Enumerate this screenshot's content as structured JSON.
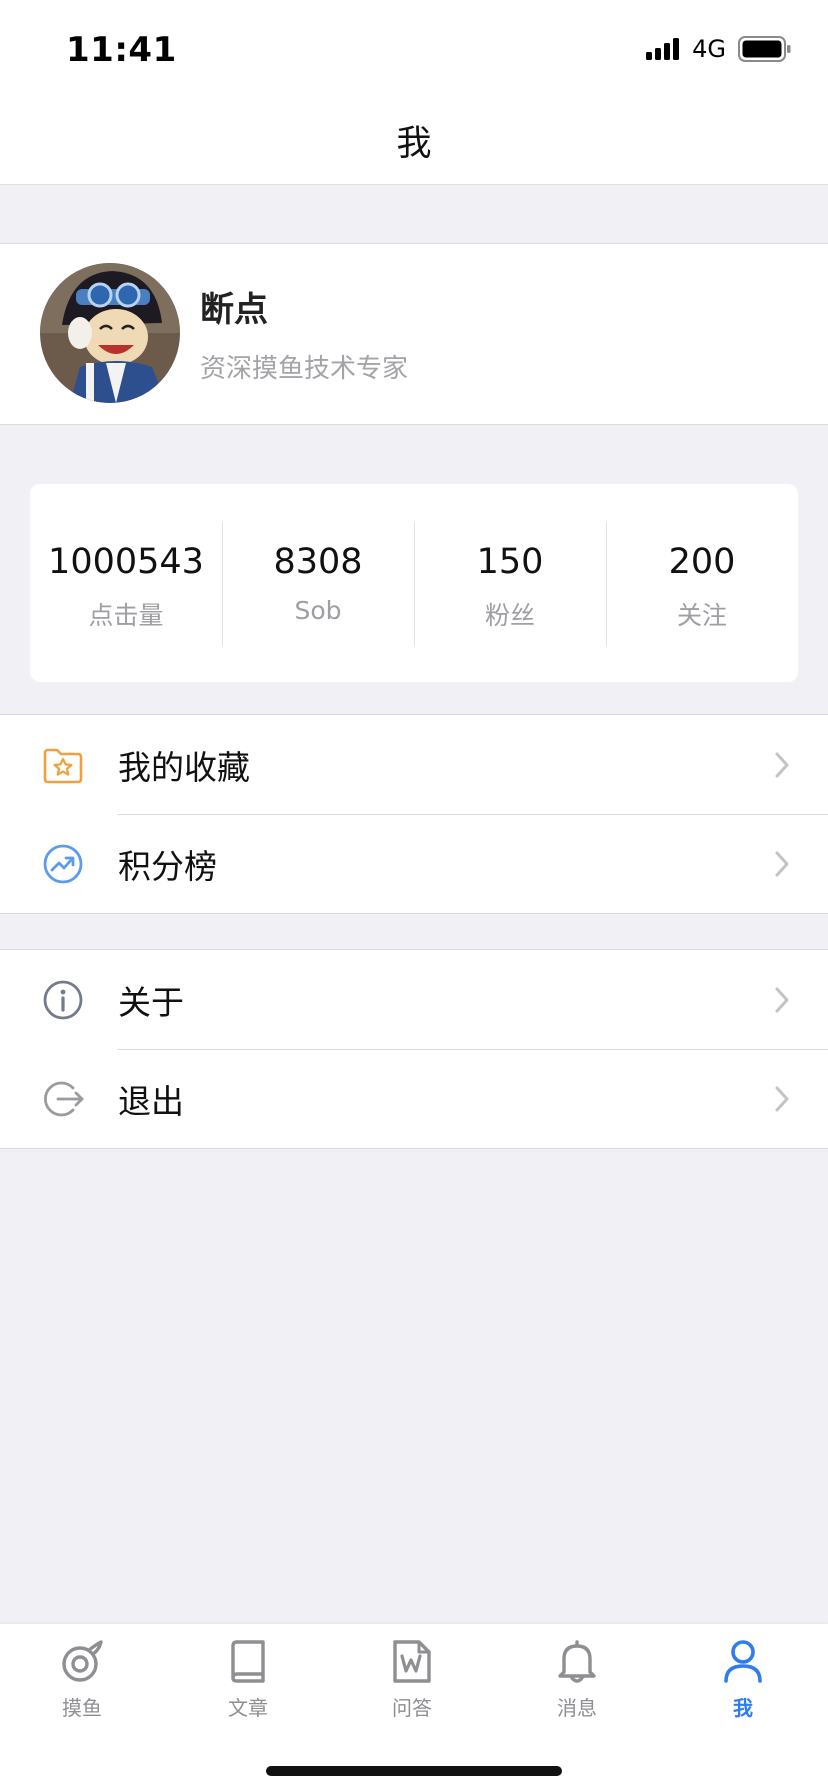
{
  "status_bar": {
    "time": "11:41",
    "network": "4G"
  },
  "nav": {
    "title": "我"
  },
  "profile": {
    "name": "断点",
    "subtitle": "资深摸鱼技术专家"
  },
  "stats": [
    {
      "value": "1000543",
      "label": "点击量"
    },
    {
      "value": "8308",
      "label": "Sob"
    },
    {
      "value": "150",
      "label": "粉丝"
    },
    {
      "value": "200",
      "label": "关注"
    }
  ],
  "menu": {
    "group1": [
      {
        "label": "我的收藏",
        "icon": "star-folder-icon",
        "color": "#f0a03c"
      },
      {
        "label": "积分榜",
        "icon": "trending-icon",
        "color": "#5b9bef"
      }
    ],
    "group2": [
      {
        "label": "关于",
        "icon": "info-icon",
        "color": "#737b8c"
      },
      {
        "label": "退出",
        "icon": "logout-icon",
        "color": "#9a9a9f"
      }
    ]
  },
  "tabs": [
    {
      "label": "摸鱼",
      "icon": "fish-icon",
      "active": false
    },
    {
      "label": "文章",
      "icon": "book-icon",
      "active": false
    },
    {
      "label": "问答",
      "icon": "qa-doc-icon",
      "active": false
    },
    {
      "label": "消息",
      "icon": "bell-icon",
      "active": false
    },
    {
      "label": "我",
      "icon": "person-icon",
      "active": true
    }
  ],
  "colors": {
    "accent": "#2d7cf0",
    "background": "#f0f0f5",
    "secondary_text": "#9e9ea3"
  }
}
